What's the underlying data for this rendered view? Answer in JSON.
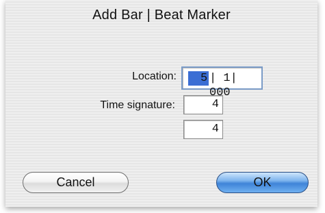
{
  "dialog": {
    "title": "Add Bar | Beat Marker"
  },
  "fields": {
    "location_label": "Location:",
    "location_selected": "5",
    "location_rest": "| 1| 000",
    "time_signature_label": "Time signature:",
    "time_signature_numerator": "4",
    "time_signature_denominator": "4"
  },
  "buttons": {
    "cancel_label": "Cancel",
    "ok_label": "OK"
  },
  "colors": {
    "selection": "#3b6ed4",
    "default_button": "#3f84d8",
    "dialog_background": "#ececec"
  }
}
